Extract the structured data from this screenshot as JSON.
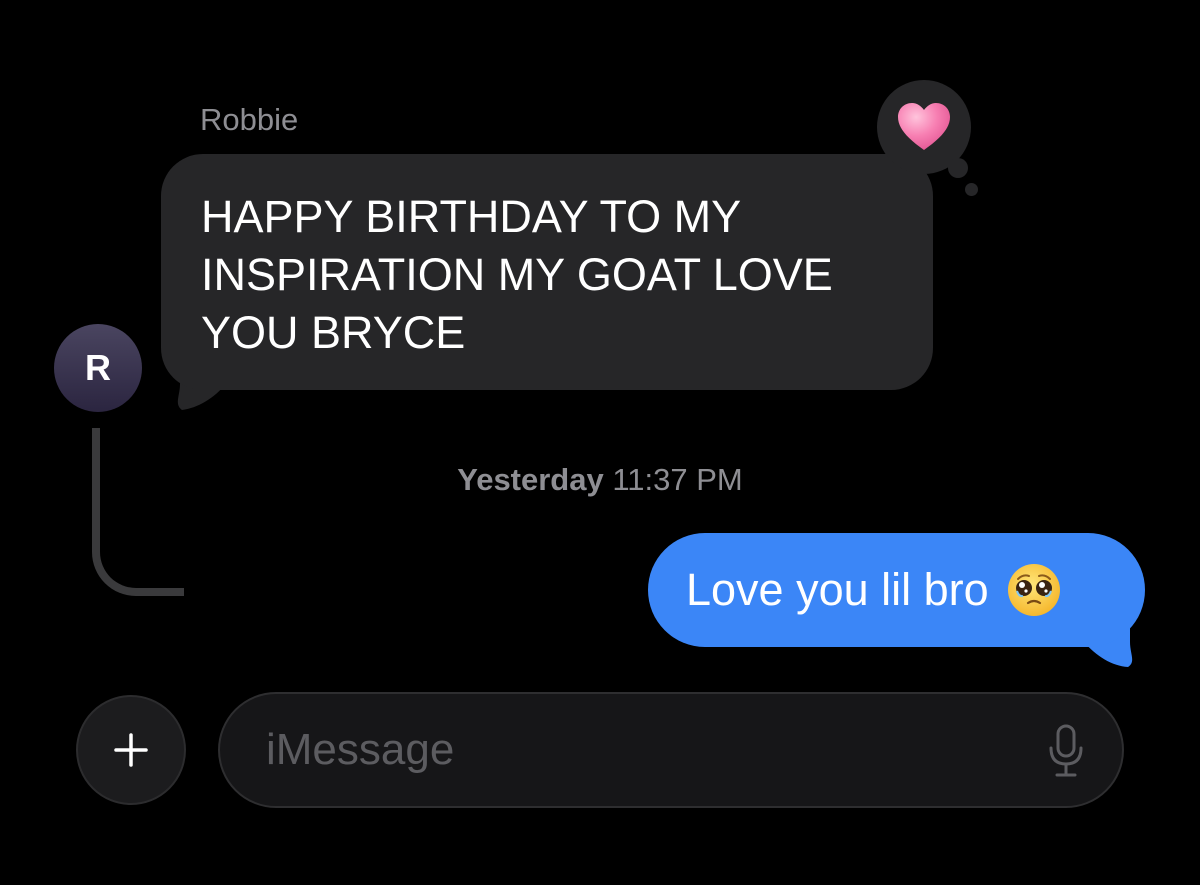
{
  "conversation": {
    "incoming": {
      "sender_name": "Robbie",
      "avatar_initial": "R",
      "lines": [
        "HAPPY BIRTHDAY TO MY",
        "INSPIRATION MY GOAT LOVE",
        "YOU BRYCE"
      ],
      "reaction": "heart-icon"
    },
    "timestamp": {
      "day": "Yesterday",
      "time": "11:37 PM"
    },
    "outgoing": {
      "text": "Love you lil bro",
      "emoji": "pleading-face-icon"
    }
  },
  "composer": {
    "placeholder": "iMessage",
    "value": "",
    "plus_icon": "plus-icon",
    "mic_icon": "microphone-icon"
  },
  "colors": {
    "background": "#000000",
    "incoming_bubble": "#262628",
    "outgoing_bubble": "#3b86f7",
    "secondary_text": "#8e8e93",
    "heart": "#f472a8"
  }
}
